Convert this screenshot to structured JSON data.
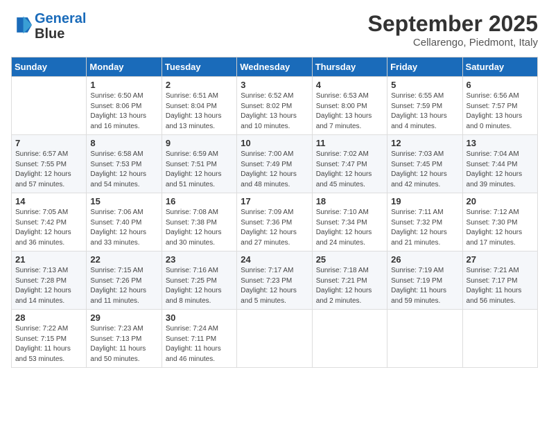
{
  "logo": {
    "line1": "General",
    "line2": "Blue"
  },
  "title": "September 2025",
  "location": "Cellarengo, Piedmont, Italy",
  "days_of_week": [
    "Sunday",
    "Monday",
    "Tuesday",
    "Wednesday",
    "Thursday",
    "Friday",
    "Saturday"
  ],
  "weeks": [
    [
      {
        "num": "",
        "detail": ""
      },
      {
        "num": "1",
        "detail": "Sunrise: 6:50 AM\nSunset: 8:06 PM\nDaylight: 13 hours\nand 16 minutes."
      },
      {
        "num": "2",
        "detail": "Sunrise: 6:51 AM\nSunset: 8:04 PM\nDaylight: 13 hours\nand 13 minutes."
      },
      {
        "num": "3",
        "detail": "Sunrise: 6:52 AM\nSunset: 8:02 PM\nDaylight: 13 hours\nand 10 minutes."
      },
      {
        "num": "4",
        "detail": "Sunrise: 6:53 AM\nSunset: 8:00 PM\nDaylight: 13 hours\nand 7 minutes."
      },
      {
        "num": "5",
        "detail": "Sunrise: 6:55 AM\nSunset: 7:59 PM\nDaylight: 13 hours\nand 4 minutes."
      },
      {
        "num": "6",
        "detail": "Sunrise: 6:56 AM\nSunset: 7:57 PM\nDaylight: 13 hours\nand 0 minutes."
      }
    ],
    [
      {
        "num": "7",
        "detail": "Sunrise: 6:57 AM\nSunset: 7:55 PM\nDaylight: 12 hours\nand 57 minutes."
      },
      {
        "num": "8",
        "detail": "Sunrise: 6:58 AM\nSunset: 7:53 PM\nDaylight: 12 hours\nand 54 minutes."
      },
      {
        "num": "9",
        "detail": "Sunrise: 6:59 AM\nSunset: 7:51 PM\nDaylight: 12 hours\nand 51 minutes."
      },
      {
        "num": "10",
        "detail": "Sunrise: 7:00 AM\nSunset: 7:49 PM\nDaylight: 12 hours\nand 48 minutes."
      },
      {
        "num": "11",
        "detail": "Sunrise: 7:02 AM\nSunset: 7:47 PM\nDaylight: 12 hours\nand 45 minutes."
      },
      {
        "num": "12",
        "detail": "Sunrise: 7:03 AM\nSunset: 7:45 PM\nDaylight: 12 hours\nand 42 minutes."
      },
      {
        "num": "13",
        "detail": "Sunrise: 7:04 AM\nSunset: 7:44 PM\nDaylight: 12 hours\nand 39 minutes."
      }
    ],
    [
      {
        "num": "14",
        "detail": "Sunrise: 7:05 AM\nSunset: 7:42 PM\nDaylight: 12 hours\nand 36 minutes."
      },
      {
        "num": "15",
        "detail": "Sunrise: 7:06 AM\nSunset: 7:40 PM\nDaylight: 12 hours\nand 33 minutes."
      },
      {
        "num": "16",
        "detail": "Sunrise: 7:08 AM\nSunset: 7:38 PM\nDaylight: 12 hours\nand 30 minutes."
      },
      {
        "num": "17",
        "detail": "Sunrise: 7:09 AM\nSunset: 7:36 PM\nDaylight: 12 hours\nand 27 minutes."
      },
      {
        "num": "18",
        "detail": "Sunrise: 7:10 AM\nSunset: 7:34 PM\nDaylight: 12 hours\nand 24 minutes."
      },
      {
        "num": "19",
        "detail": "Sunrise: 7:11 AM\nSunset: 7:32 PM\nDaylight: 12 hours\nand 21 minutes."
      },
      {
        "num": "20",
        "detail": "Sunrise: 7:12 AM\nSunset: 7:30 PM\nDaylight: 12 hours\nand 17 minutes."
      }
    ],
    [
      {
        "num": "21",
        "detail": "Sunrise: 7:13 AM\nSunset: 7:28 PM\nDaylight: 12 hours\nand 14 minutes."
      },
      {
        "num": "22",
        "detail": "Sunrise: 7:15 AM\nSunset: 7:26 PM\nDaylight: 12 hours\nand 11 minutes."
      },
      {
        "num": "23",
        "detail": "Sunrise: 7:16 AM\nSunset: 7:25 PM\nDaylight: 12 hours\nand 8 minutes."
      },
      {
        "num": "24",
        "detail": "Sunrise: 7:17 AM\nSunset: 7:23 PM\nDaylight: 12 hours\nand 5 minutes."
      },
      {
        "num": "25",
        "detail": "Sunrise: 7:18 AM\nSunset: 7:21 PM\nDaylight: 12 hours\nand 2 minutes."
      },
      {
        "num": "26",
        "detail": "Sunrise: 7:19 AM\nSunset: 7:19 PM\nDaylight: 11 hours\nand 59 minutes."
      },
      {
        "num": "27",
        "detail": "Sunrise: 7:21 AM\nSunset: 7:17 PM\nDaylight: 11 hours\nand 56 minutes."
      }
    ],
    [
      {
        "num": "28",
        "detail": "Sunrise: 7:22 AM\nSunset: 7:15 PM\nDaylight: 11 hours\nand 53 minutes."
      },
      {
        "num": "29",
        "detail": "Sunrise: 7:23 AM\nSunset: 7:13 PM\nDaylight: 11 hours\nand 50 minutes."
      },
      {
        "num": "30",
        "detail": "Sunrise: 7:24 AM\nSunset: 7:11 PM\nDaylight: 11 hours\nand 46 minutes."
      },
      {
        "num": "",
        "detail": ""
      },
      {
        "num": "",
        "detail": ""
      },
      {
        "num": "",
        "detail": ""
      },
      {
        "num": "",
        "detail": ""
      }
    ]
  ]
}
